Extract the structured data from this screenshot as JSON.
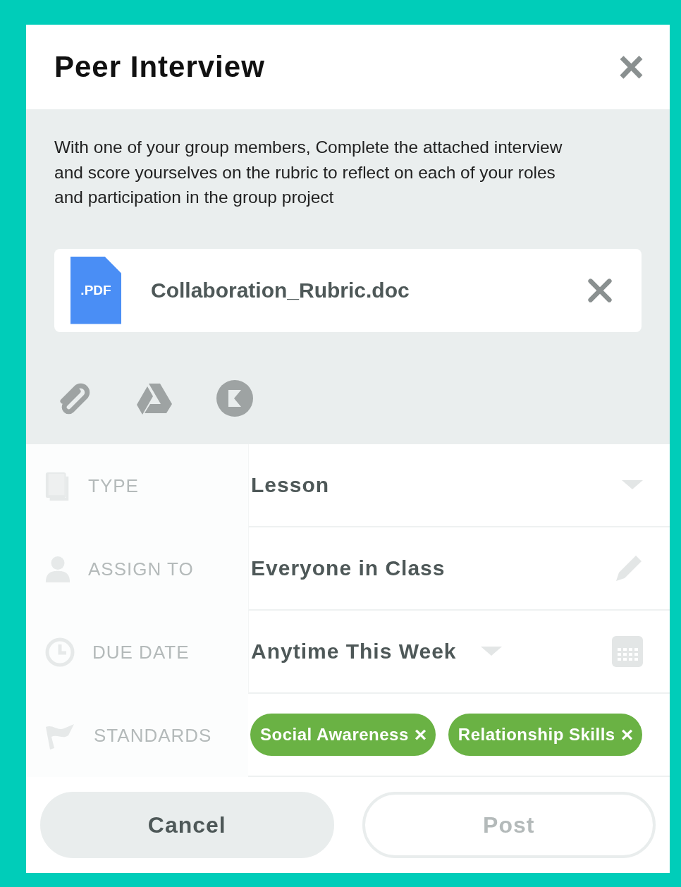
{
  "dialog": {
    "title": "Peer Interview",
    "close": "×"
  },
  "description": "With one of your group members, Complete the attached interview and score yourselves on the rubric to reflect on each of your roles and participation in the group project",
  "attachment": {
    "badge": ".PDF",
    "filename": "Collaboration_Rubric.doc"
  },
  "fields": [
    {
      "kind": "dropdown",
      "label": "TYPE",
      "value": "Lesson"
    },
    {
      "kind": "editable",
      "label": "ASSIGN TO",
      "value": "Everyone in Class"
    },
    {
      "kind": "date",
      "label": "DUE DATE",
      "value": "Anytime This Week"
    },
    {
      "kind": "tags",
      "label": "STANDARDS",
      "tags": [
        {
          "text": "Social Awareness",
          "remove": "×"
        },
        {
          "text": "Relationship Skills",
          "remove": "×"
        }
      ]
    }
  ],
  "buttons": [
    {
      "label": "Cancel",
      "disabled": false
    },
    {
      "label": "Post",
      "disabled": true
    }
  ]
}
